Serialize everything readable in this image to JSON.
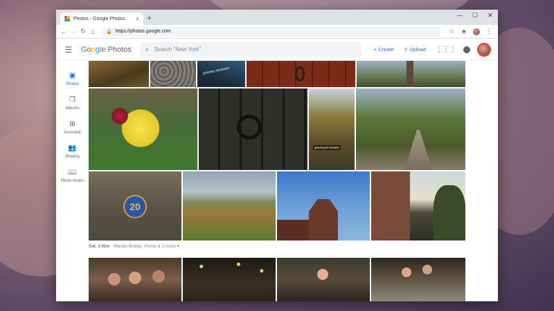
{
  "browser": {
    "tab_title": "Photos - Google Photos",
    "tab_close": "×",
    "new_tab": "+",
    "url": "https://photos.google.com",
    "controls": {
      "minimize": "—",
      "maximize": "☐",
      "close": "✕"
    }
  },
  "app": {
    "logo_google": [
      "G",
      "o",
      "o",
      "g",
      "l",
      "e"
    ],
    "logo_photos": "Photos",
    "search_placeholder": "Search \"New York\"",
    "create_label": "+ Create",
    "upload_label": "⇪ Upload"
  },
  "nav": {
    "items": [
      {
        "label": "Photos",
        "icon": "photos-icon",
        "glyph": "▣",
        "active": true
      },
      {
        "label": "Albums",
        "icon": "albums-icon",
        "glyph": "❐",
        "active": false
      },
      {
        "label": "Assistant",
        "icon": "assistant-icon",
        "glyph": "⊞",
        "active": false
      },
      {
        "label": "Sharing",
        "icon": "sharing-icon",
        "glyph": "👥",
        "active": false
      },
      {
        "label": "Photo books",
        "icon": "photo-books-icon",
        "glyph": "📖",
        "active": false
      }
    ]
  },
  "gallery": {
    "overlay_phone_reviews": "phone reviews",
    "overlay_graveyard": "graveyard streaks",
    "sign_number": "20",
    "section_date": "Sat, 3 Nov",
    "section_location": "Marple Bridge, Home & 2 more ▾"
  },
  "colors": {
    "accent": "#1a73e8",
    "icon_gray": "#5f6368"
  }
}
